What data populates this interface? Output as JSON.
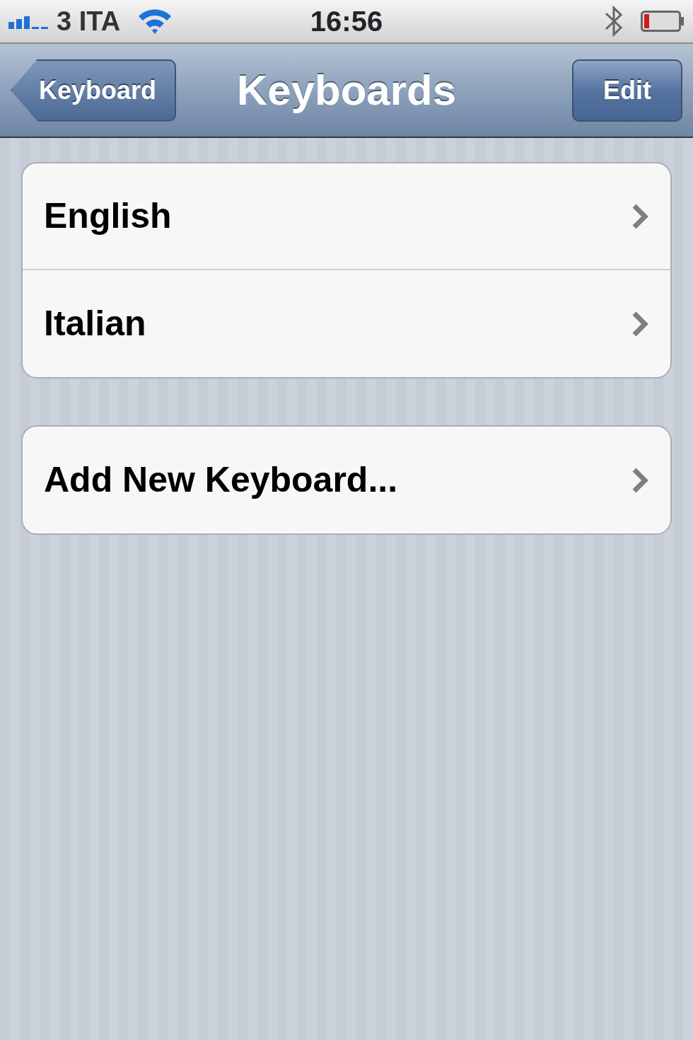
{
  "status_bar": {
    "carrier": "3 ITA",
    "time": "16:56"
  },
  "nav_bar": {
    "back": "Keyboard",
    "title": "Keyboards",
    "action": "Edit"
  },
  "groups": [
    {
      "items": [
        {
          "label": "English"
        },
        {
          "label": "Italian"
        }
      ]
    },
    {
      "items": [
        {
          "label": "Add New Keyboard..."
        }
      ]
    }
  ]
}
